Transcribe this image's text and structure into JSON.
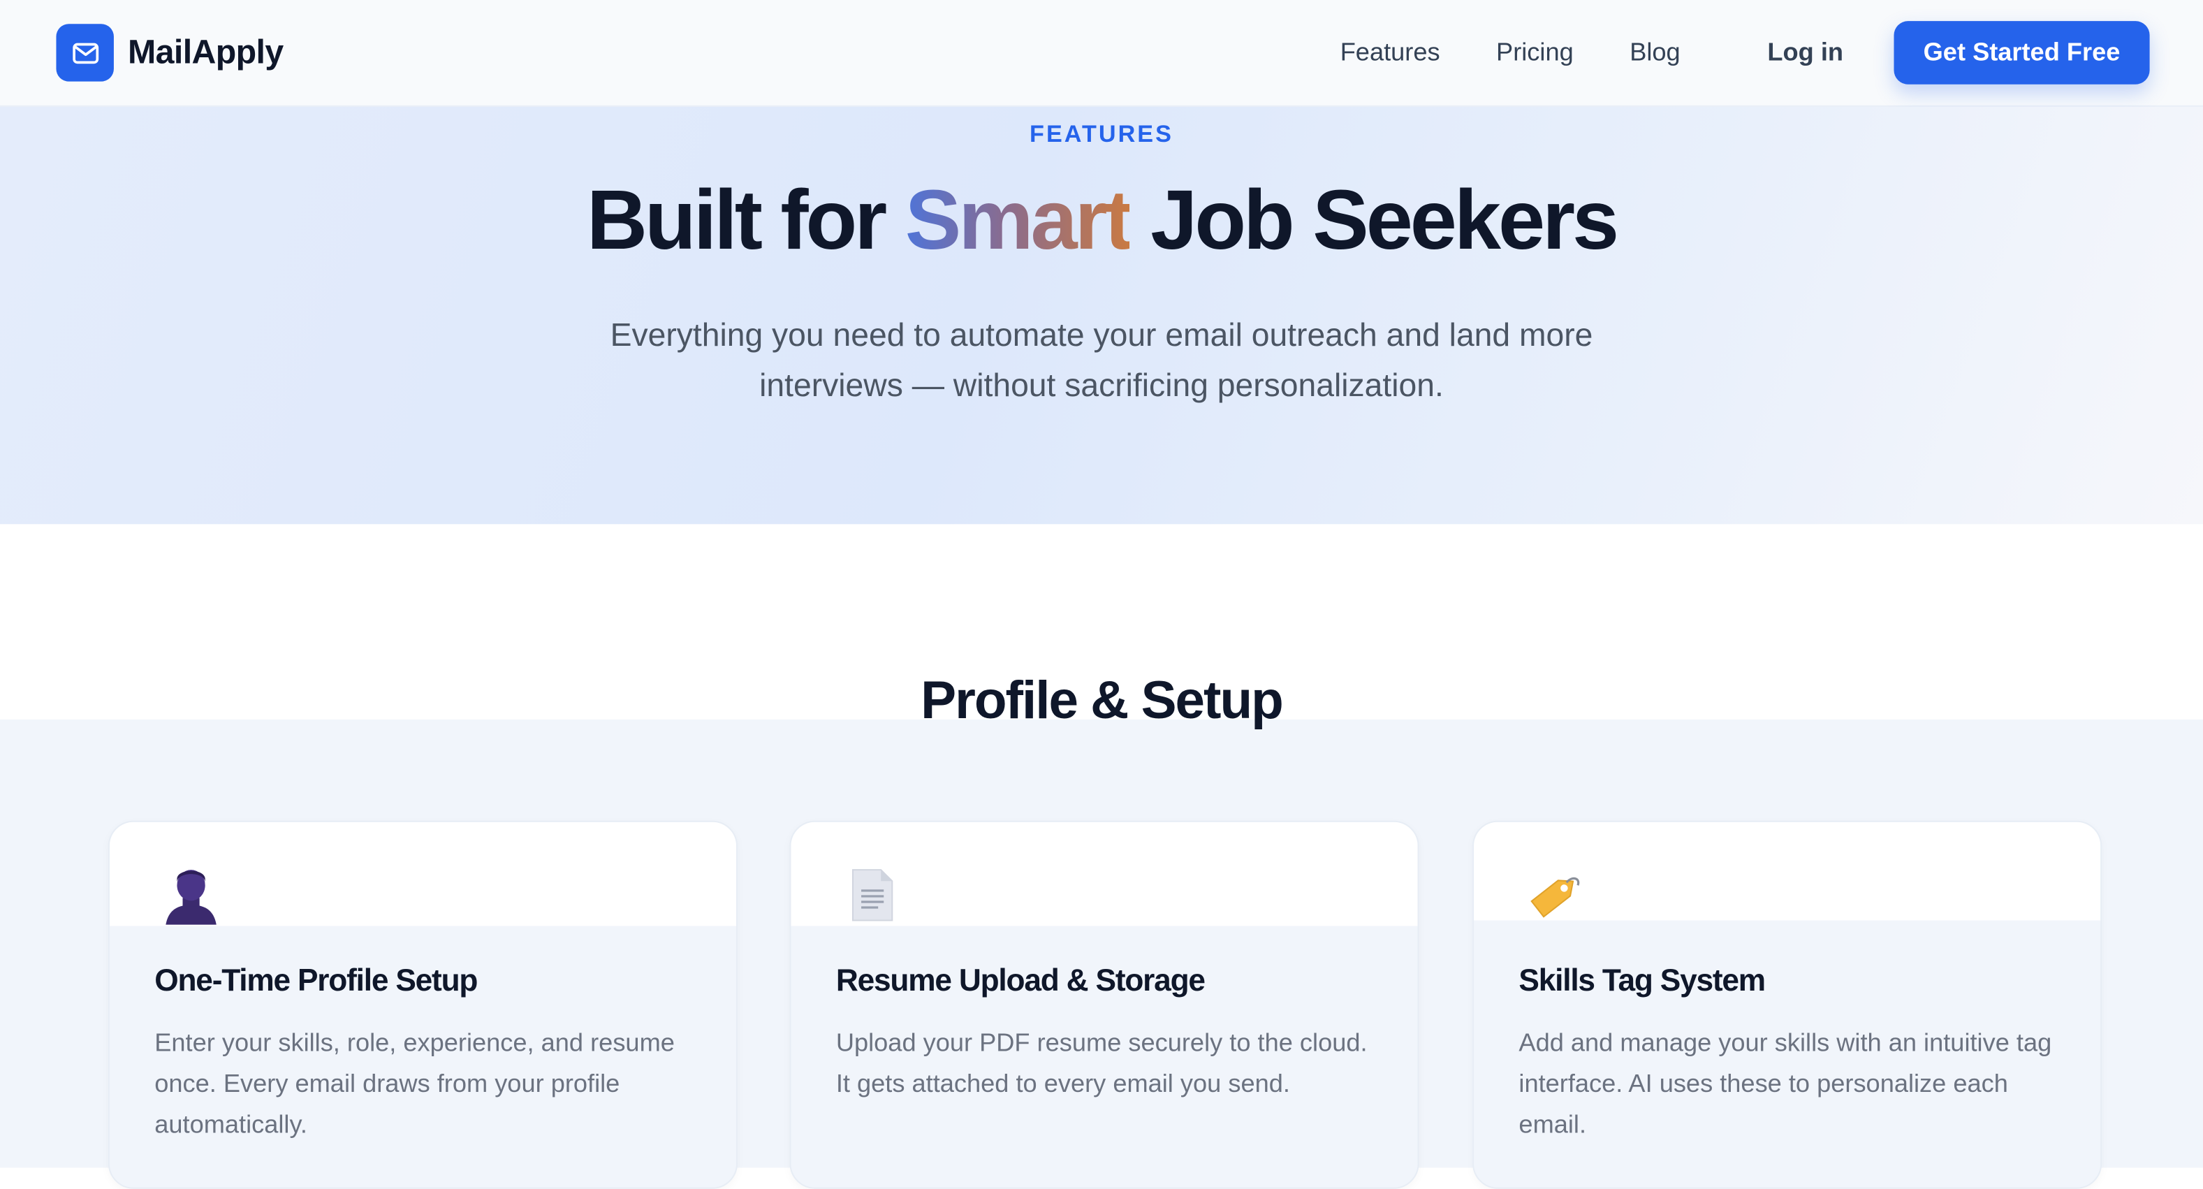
{
  "brand": {
    "name": "MailApply",
    "icon": "mail-icon",
    "accent": "#2563eb"
  },
  "nav": {
    "links": [
      "Features",
      "Pricing",
      "Blog"
    ],
    "login": "Log in",
    "cta": "Get Started Free"
  },
  "hero": {
    "eyebrow": "FEATURES",
    "title_pre": "Built for ",
    "title_highlight": "Smart",
    "title_post": " Job Seekers",
    "subtitle": "Everything you need to automate your email outreach and land more interviews — without sacrificing personalization."
  },
  "section": {
    "title": "Profile & Setup",
    "cards": [
      {
        "icon": "person-icon",
        "title": "One-Time Profile Setup",
        "description": "Enter your skills, role, experience, and resume once. Every email draws from your profile automatically."
      },
      {
        "icon": "document-icon",
        "title": "Resume Upload & Storage",
        "description": "Upload your PDF resume securely to the cloud. It gets attached to every email you send."
      },
      {
        "icon": "tag-icon",
        "title": "Skills Tag System",
        "description": "Add and manage your skills with an intuitive tag interface. AI uses these to personalize each email."
      }
    ]
  }
}
